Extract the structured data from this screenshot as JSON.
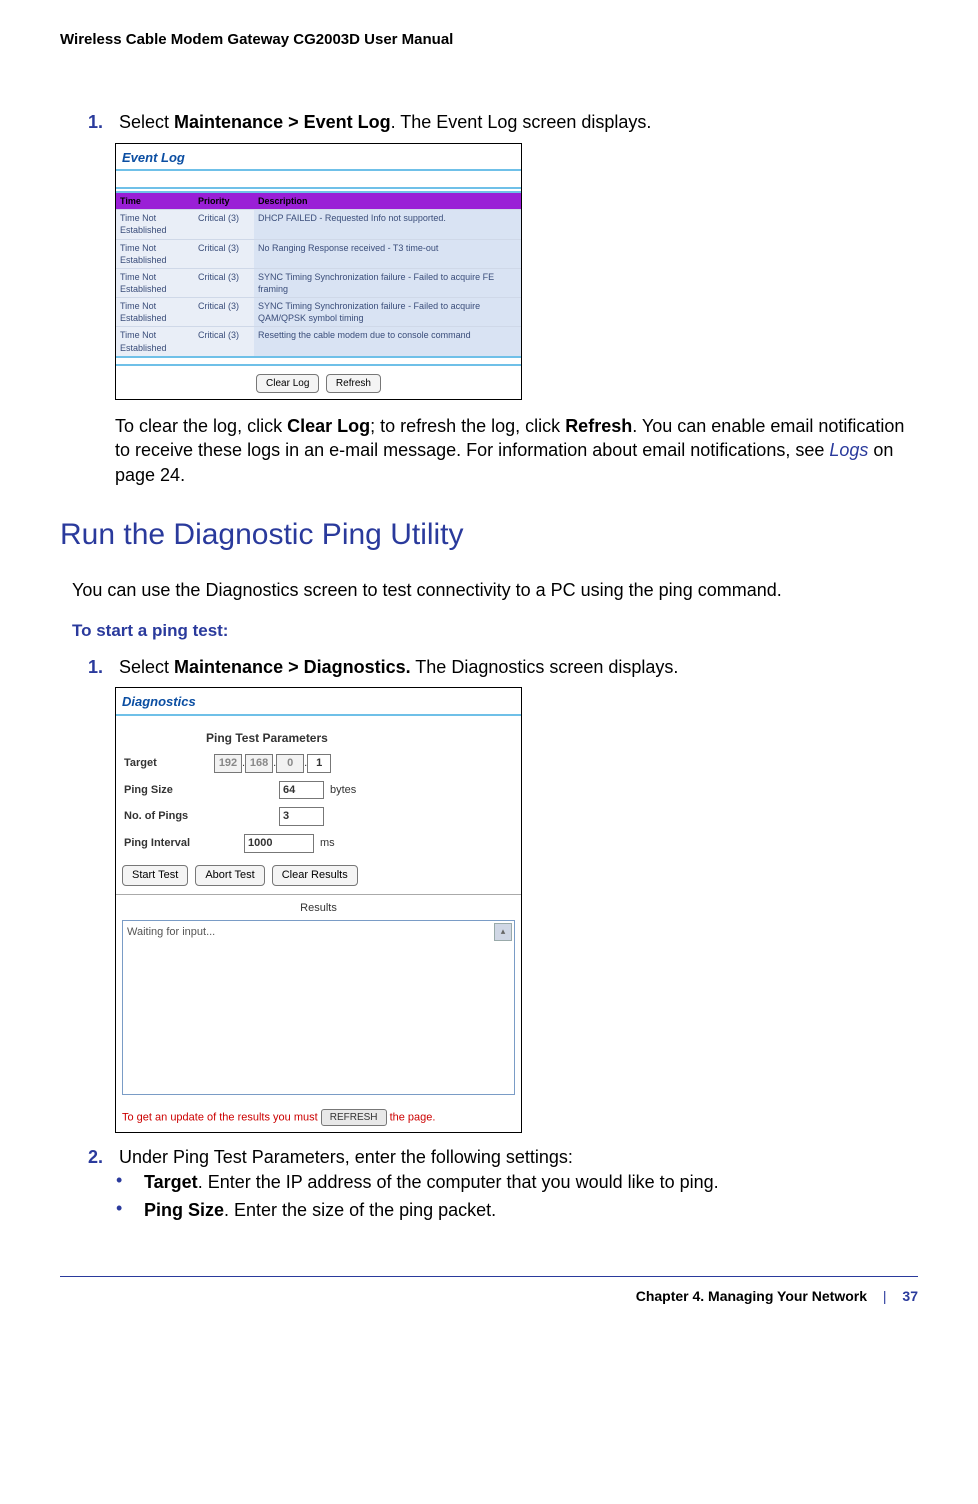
{
  "doc_header": "Wireless Cable Modem Gateway CG2003D User Manual",
  "step1": {
    "num": "1.",
    "pre": "Select ",
    "bold": "Maintenance > Event Log",
    "post": ". The Event Log screen displays."
  },
  "ss1": {
    "title": "Event Log",
    "hdr_time": "Time",
    "hdr_priority": "Priority",
    "hdr_desc": "Description",
    "rows": [
      {
        "time": "Time Not Established",
        "prio": "Critical (3)",
        "desc": "DHCP FAILED - Requested Info not supported."
      },
      {
        "time": "Time Not Established",
        "prio": "Critical (3)",
        "desc": "No Ranging Response received - T3 time-out"
      },
      {
        "time": "Time Not Established",
        "prio": "Critical (3)",
        "desc": "SYNC Timing Synchronization failure - Failed to acquire FE framing"
      },
      {
        "time": "Time Not Established",
        "prio": "Critical (3)",
        "desc": "SYNC Timing Synchronization failure - Failed to acquire QAM/QPSK symbol timing"
      },
      {
        "time": "Time Not Established",
        "prio": "Critical (3)",
        "desc": "Resetting the cable modem due to console command"
      }
    ],
    "btn_clear": "Clear Log",
    "btn_refresh": "Refresh"
  },
  "para_clear": {
    "p1": "To clear the log, click ",
    "b1": "Clear Log",
    "p2": "; to refresh the log, click ",
    "b2": "Refresh",
    "p3": ". You can enable email notification to receive these logs in an e-mail message. For information about email notifications, see ",
    "link": "Logs",
    "p4": " on page 24."
  },
  "section_head": "Run the Diagnostic Ping Utility",
  "diag_intro": "You can use the Diagnostics screen to test connectivity to a PC using the ping command.",
  "ping_subhead": "To start a ping test:",
  "step_diag1": {
    "num": "1.",
    "pre": "Select ",
    "bold": "Maintenance > Diagnostics.",
    "post": " The Diagnostics screen displays."
  },
  "ss2": {
    "title": "Diagnostics",
    "param_hdr": "Ping Test Parameters",
    "lbl_target": "Target",
    "ip": [
      "192",
      "168",
      "0",
      "1"
    ],
    "lbl_size": "Ping Size",
    "val_size": "64",
    "unit_size": "bytes",
    "lbl_pings": "No. of Pings",
    "val_pings": "3",
    "lbl_interval": "Ping Interval",
    "val_interval": "1000",
    "unit_interval": "ms",
    "btn_start": "Start Test",
    "btn_abort": "Abort Test",
    "btn_clear": "Clear Results",
    "results_lbl": "Results",
    "results_text": "Waiting for input...",
    "footer_pre": "To get an update of the results you must ",
    "btn_refresh": "REFRESH",
    "footer_post": " the page."
  },
  "step2": {
    "num": "2.",
    "text": "Under Ping Test Parameters, enter the following settings:"
  },
  "bullet1": {
    "bold": "Target",
    "rest": ". Enter the IP address of the computer that you would like to ping."
  },
  "bullet2": {
    "bold": "Ping Size",
    "rest": ". Enter the size of the ping packet."
  },
  "footer": {
    "chapter": "Chapter 4.  Managing Your Network",
    "page": "37"
  }
}
